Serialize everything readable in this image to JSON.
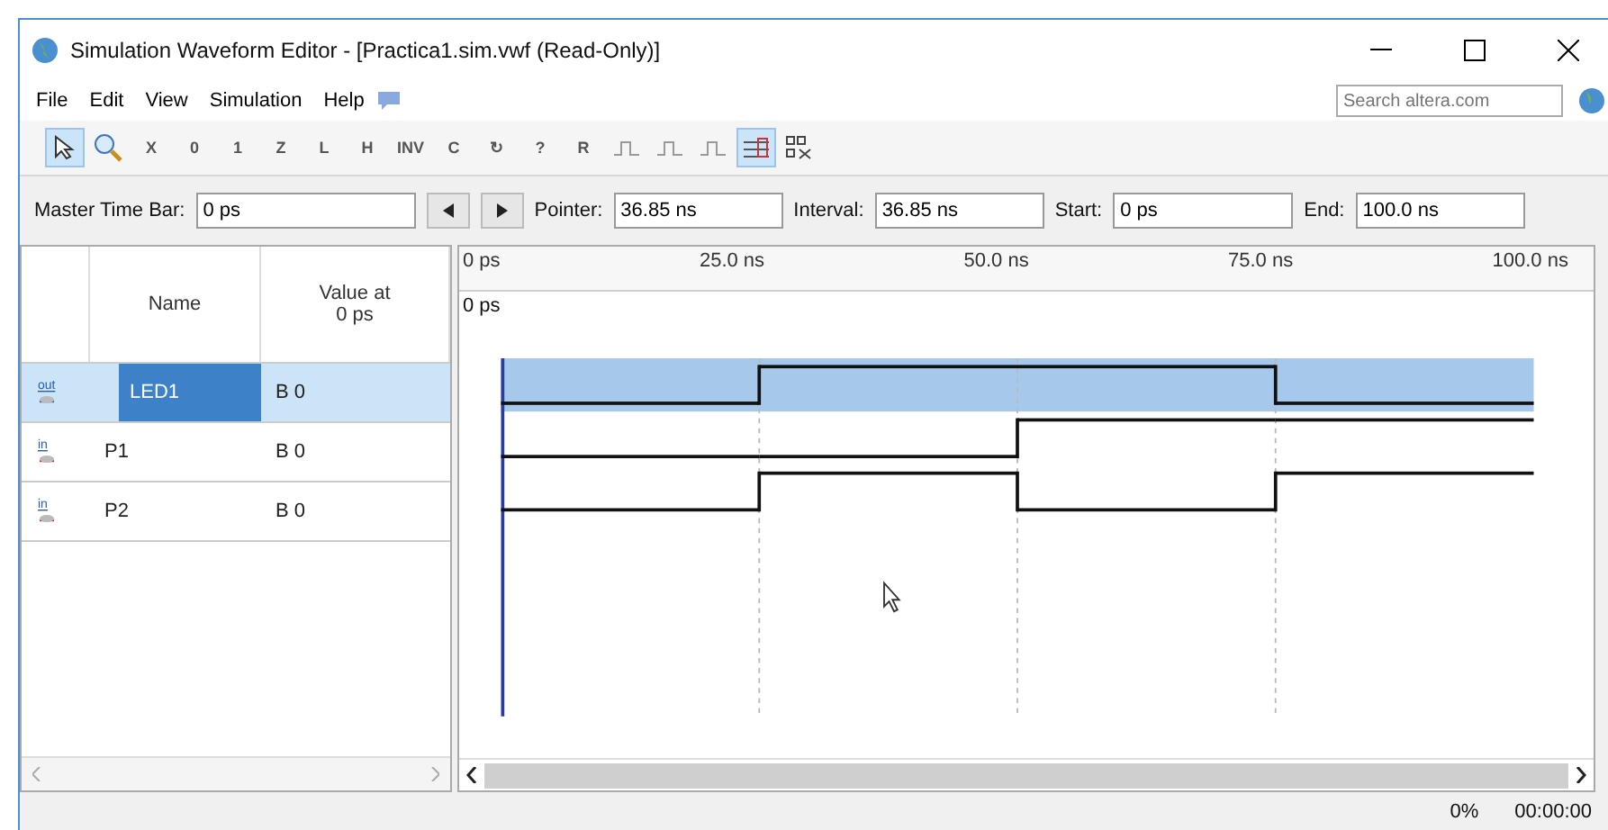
{
  "window": {
    "title": "Simulation Waveform Editor - [Practica1.sim.vwf (Read-Only)]"
  },
  "menu": [
    {
      "label": "File"
    },
    {
      "label": "Edit"
    },
    {
      "label": "View"
    },
    {
      "label": "Simulation"
    },
    {
      "label": "Help"
    }
  ],
  "search": {
    "placeholder": "Search altera.com"
  },
  "toolbar": [
    {
      "kind": "pointer",
      "selected": true
    },
    {
      "kind": "zoom",
      "selected": false
    },
    {
      "kind": "letter",
      "label": "X",
      "selected": false
    },
    {
      "kind": "letter",
      "label": "0",
      "selected": false
    },
    {
      "kind": "letter",
      "label": "1",
      "selected": false
    },
    {
      "kind": "letter",
      "label": "Z",
      "selected": false
    },
    {
      "kind": "letter",
      "label": "L",
      "selected": false
    },
    {
      "kind": "letter",
      "label": "H",
      "selected": false
    },
    {
      "kind": "letter",
      "label": "INV",
      "selected": false
    },
    {
      "kind": "letter",
      "label": "C",
      "selected": false
    },
    {
      "kind": "letter",
      "label": "↻",
      "selected": false
    },
    {
      "kind": "letter",
      "label": "?",
      "selected": false
    },
    {
      "kind": "letter",
      "label": "R",
      "selected": false
    },
    {
      "kind": "wave",
      "selected": false
    },
    {
      "kind": "wave",
      "selected": false
    },
    {
      "kind": "wave",
      "selected": false
    },
    {
      "kind": "grid",
      "selected": true
    },
    {
      "kind": "nodes",
      "selected": false
    }
  ],
  "time_bar": {
    "master_label": "Master Time Bar:",
    "master_value": "0 ps",
    "pointer_label": "Pointer:",
    "pointer_value": "36.85 ns",
    "interval_label": "Interval:",
    "interval_value": "36.85 ns",
    "start_label": "Start:",
    "start_value": "0 ps",
    "end_label": "End:",
    "end_value": "100.0 ns"
  },
  "table": {
    "columns": [
      "Name",
      "Value at\n0 ps"
    ],
    "rows": [
      {
        "kind": "out",
        "type_label": "out",
        "name": "LED1",
        "value": "B 0",
        "selected": true,
        "waveform": [
          {
            "high": false
          },
          {
            "high": true
          },
          {
            "high": true
          },
          {
            "high": false
          }
        ]
      },
      {
        "kind": "in",
        "type_label": "in",
        "name": "P1",
        "value": "B 0",
        "selected": false,
        "waveform": [
          {
            "high": false
          },
          {
            "high": false
          },
          {
            "high": true
          },
          {
            "high": true
          }
        ]
      },
      {
        "kind": "in",
        "type_label": "in",
        "name": "P2",
        "value": "B 0",
        "selected": false,
        "waveform": [
          {
            "high": false
          },
          {
            "high": true
          },
          {
            "high": false
          },
          {
            "high": true
          }
        ]
      }
    ]
  },
  "timeline": {
    "ticks": [
      "0 ps",
      "25.0 ns",
      "50.0 ns",
      "75.0 ns",
      "100.0 ns"
    ],
    "marker": "0 ps"
  },
  "status_bar": {
    "progress": "0%",
    "time": "00:00:00"
  }
}
